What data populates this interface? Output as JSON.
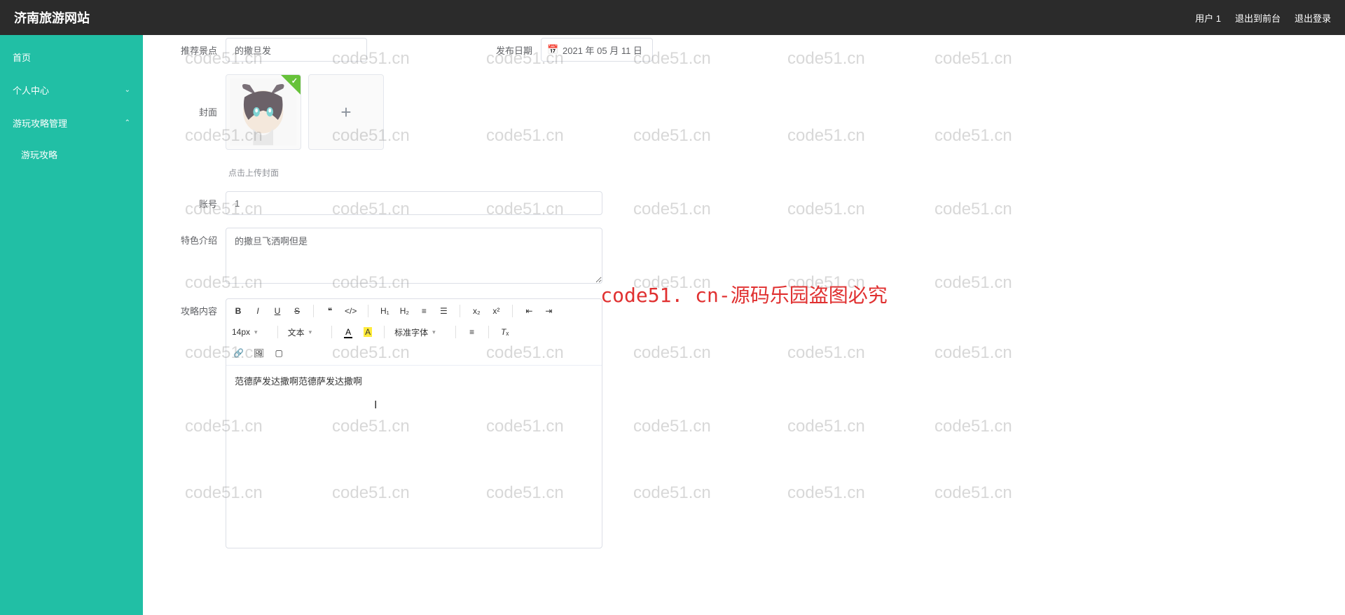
{
  "topbar": {
    "title": "济南旅游网站",
    "user": "用户 1",
    "exit_front": "退出到前台",
    "logout": "退出登录"
  },
  "sidebar": {
    "home": "首页",
    "personal": "个人中心",
    "strategy_mgmt": "游玩攻略管理",
    "strategy": "游玩攻略"
  },
  "form": {
    "recommend_label": "推荐景点",
    "recommend_value": "的撒旦发",
    "publish_label": "发布日期",
    "publish_value": "2021 年 05 月 11 日",
    "cover_label": "封面",
    "cover_hint": "点击上传封面",
    "account_label": "账号",
    "account_value": "1",
    "feature_label": "特色介绍",
    "feature_value": "的撒旦飞洒啊但是",
    "content_label": "攻略内容",
    "editor_content": "范德萨发达撒啊范德萨发达撒啊"
  },
  "editor": {
    "font_size": "14px",
    "font_type": "文本",
    "font_family": "标准字体"
  },
  "watermark": "code51.cn",
  "center_overlay": "code51. cn-源码乐园盗图必究"
}
